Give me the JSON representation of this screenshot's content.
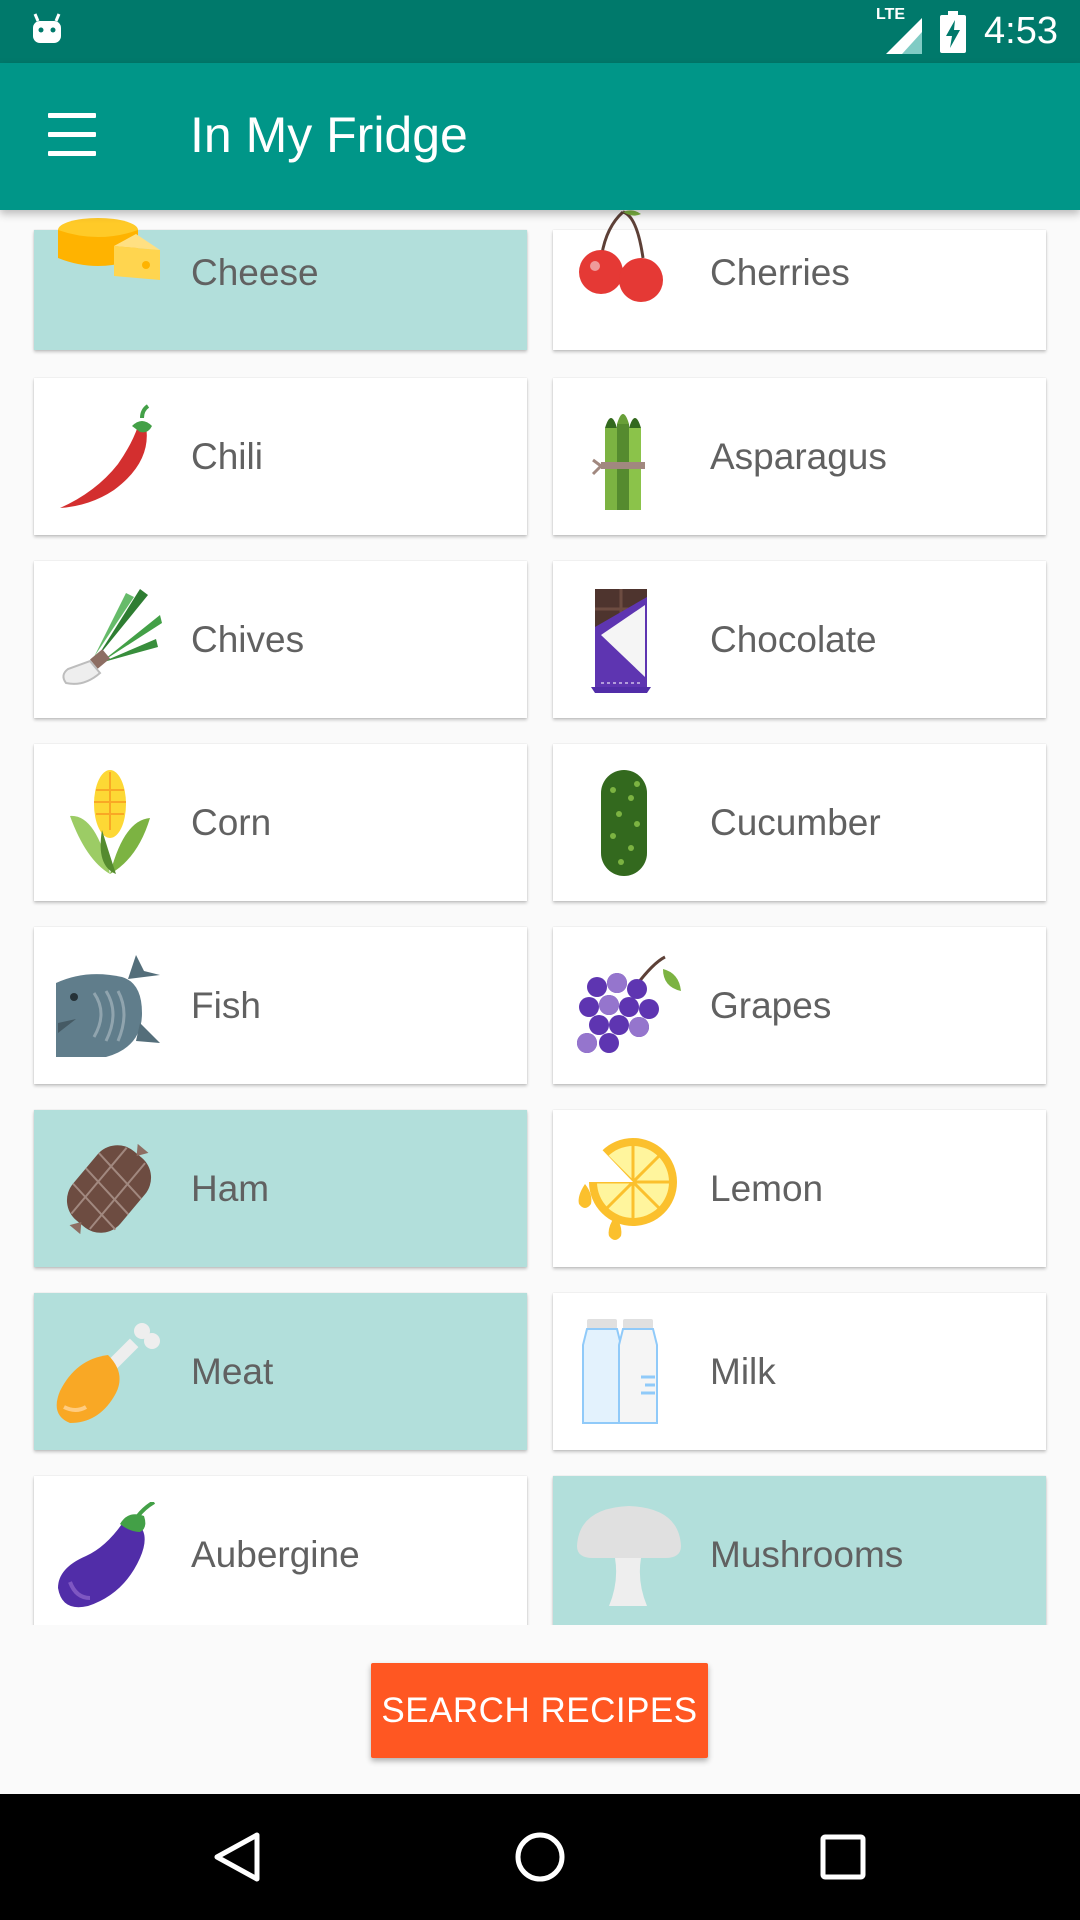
{
  "status_bar": {
    "network": "LTE",
    "time": "4:53"
  },
  "app_bar": {
    "title": "In My Fridge"
  },
  "items": [
    {
      "label": "Cheese",
      "icon": "cheese-icon",
      "selected": true
    },
    {
      "label": "Cherries",
      "icon": "cherries-icon",
      "selected": false
    },
    {
      "label": "Chili",
      "icon": "chili-icon",
      "selected": false
    },
    {
      "label": "Asparagus",
      "icon": "asparagus-icon",
      "selected": false
    },
    {
      "label": "Chives",
      "icon": "chives-icon",
      "selected": false
    },
    {
      "label": "Chocolate",
      "icon": "chocolate-icon",
      "selected": false
    },
    {
      "label": "Corn",
      "icon": "corn-icon",
      "selected": false
    },
    {
      "label": "Cucumber",
      "icon": "cucumber-icon",
      "selected": false
    },
    {
      "label": "Fish",
      "icon": "fish-icon",
      "selected": false
    },
    {
      "label": "Grapes",
      "icon": "grapes-icon",
      "selected": false
    },
    {
      "label": "Ham",
      "icon": "ham-icon",
      "selected": true
    },
    {
      "label": "Lemon",
      "icon": "lemon-icon",
      "selected": false
    },
    {
      "label": "Meat",
      "icon": "meat-icon",
      "selected": true
    },
    {
      "label": "Milk",
      "icon": "milk-icon",
      "selected": false
    },
    {
      "label": "Aubergine",
      "icon": "aubergine-icon",
      "selected": false
    },
    {
      "label": "Mushrooms",
      "icon": "mushroom-icon",
      "selected": true
    }
  ],
  "search_button": {
    "label": "SEARCH RECIPES"
  },
  "colors": {
    "status_bar": "#00796b",
    "app_bar": "#009688",
    "selected_card": "#b2dfdb",
    "accent": "#ff5722"
  }
}
